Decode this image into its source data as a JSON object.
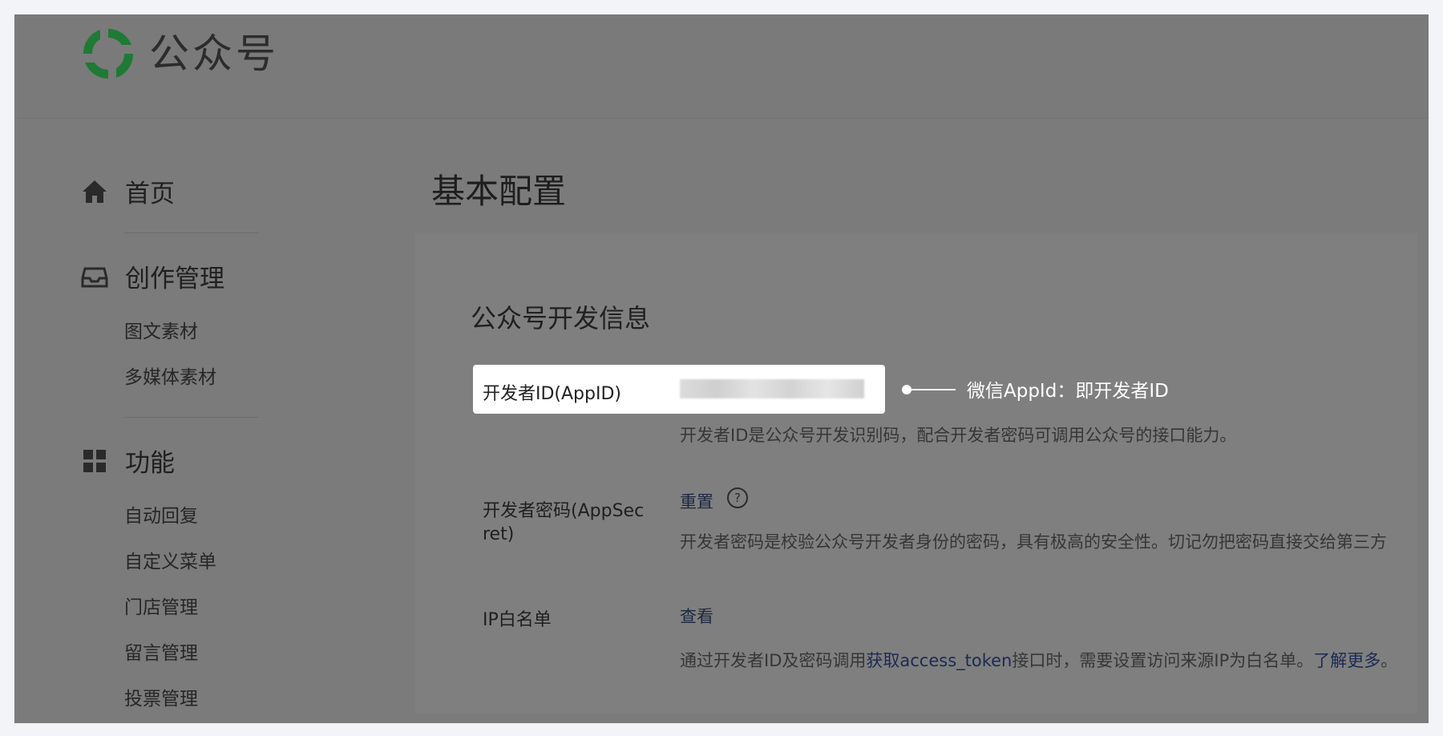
{
  "header": {
    "brand": "公众号",
    "logo": "wechat-mp-logo-icon",
    "logo_color": "#1f7a35"
  },
  "sidebar": {
    "groups": [
      {
        "label": "首页",
        "icon": "home-icon",
        "items": []
      },
      {
        "label": "创作管理",
        "icon": "inbox-icon",
        "items": [
          "图文素材",
          "多媒体素材"
        ]
      },
      {
        "label": "功能",
        "icon": "grid-icon",
        "items": [
          "自动回复",
          "自定义菜单",
          "门店管理",
          "留言管理",
          "投票管理"
        ]
      }
    ]
  },
  "main": {
    "title": "基本配置",
    "section_title": "公众号开发信息",
    "rows": [
      {
        "label": "开发者ID(AppID)",
        "value_redacted": true,
        "desc": "开发者ID是公众号开发识别码，配合开发者密码可调用公众号的接口能力。"
      },
      {
        "label_line1": "开发者密码(AppSec",
        "label_line2": "ret)",
        "action": "重置",
        "help_icon": "question-circle-icon",
        "desc": "开发者密码是校验公众号开发者身份的密码，具有极高的安全性。切记勿把密码直接交给第三方"
      },
      {
        "label": "IP白名单",
        "action": "查看",
        "desc_prefix": "通过开发者ID及密码调用",
        "desc_link1": "获取access_token",
        "desc_middle": "接口时，需要设置访问来源IP为白名单。",
        "desc_link2": "了解更多",
        "desc_suffix": "。"
      }
    ]
  },
  "annotation": {
    "text": "微信AppId：即开发者ID",
    "color": "#ffffff"
  },
  "colors": {
    "overlay": "#7b7b7b",
    "highlight_bg": "#ffffff",
    "page_bg": "#f3f4f8"
  }
}
